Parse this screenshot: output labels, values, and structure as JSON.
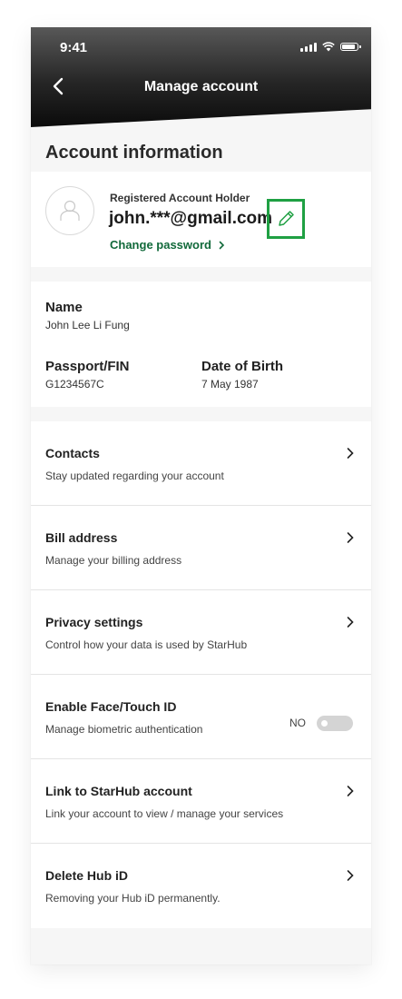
{
  "status_bar": {
    "time": "9:41"
  },
  "header": {
    "title": "Manage account",
    "back_icon": "chevron-left-icon"
  },
  "section_title": "Account information",
  "account": {
    "holder_label": "Registered Account Holder",
    "email": "john.***@gmail.com",
    "change_password": "Change password",
    "edit_icon": "pencil-icon",
    "accent": "#1fa043"
  },
  "personal": {
    "name_label": "Name",
    "name_value": "John Lee Li Fung",
    "passport_label": "Passport/FIN",
    "passport_value": "G1234567C",
    "dob_label": "Date of Birth",
    "dob_value": "7 May 1987"
  },
  "menu": {
    "items": [
      {
        "title": "Contacts",
        "subtitle": "Stay updated regarding your account"
      },
      {
        "title": "Bill address",
        "subtitle": "Manage your billing address"
      },
      {
        "title": "Privacy settings",
        "subtitle": "Control how your data is used by StarHub"
      },
      {
        "title": "Enable Face/Touch ID",
        "subtitle": "Manage biometric authentication",
        "toggle_label": "NO",
        "toggle_on": false
      },
      {
        "title": "Link to StarHub account",
        "subtitle": "Link your account to view / manage your services"
      },
      {
        "title": "Delete Hub iD",
        "subtitle": "Removing your Hub iD permanently."
      }
    ]
  }
}
